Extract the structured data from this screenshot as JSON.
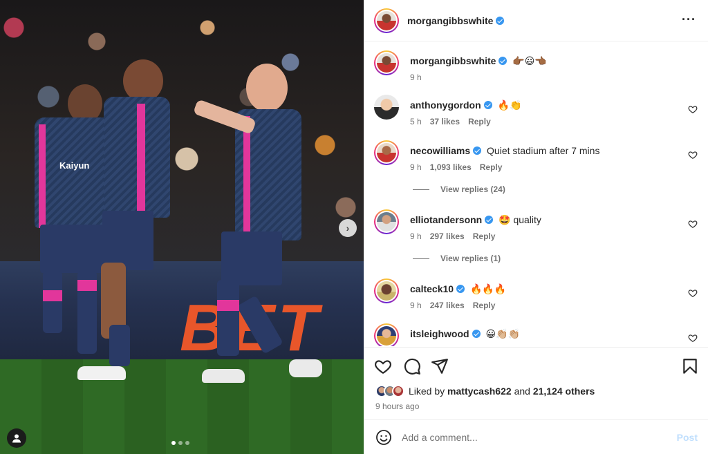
{
  "post": {
    "author": "morgangibbswhite",
    "caption_emoji": "👉🏾😃👈🏾",
    "caption_time": "9 h",
    "more_icon": "more-horizontal-icon"
  },
  "comments": [
    {
      "user": "anthonygordon",
      "text": "🔥👏",
      "time": "5 h",
      "likes": "37 likes",
      "reply": "Reply"
    },
    {
      "user": "necowilliams",
      "text": "Quiet stadium after 7 mins",
      "time": "9 h",
      "likes": "1,093 likes",
      "reply": "Reply",
      "view_replies": "View replies (24)"
    },
    {
      "user": "elliotandersonn",
      "text": "🤩 quality",
      "time": "9 h",
      "likes": "297 likes",
      "reply": "Reply",
      "view_replies": "View replies (1)"
    },
    {
      "user": "calteck10",
      "text": "🔥🔥🔥",
      "time": "9 h",
      "likes": "247 likes",
      "reply": "Reply"
    },
    {
      "user": "itsleighwood",
      "text": "😀👏🏼👏🏼",
      "time": "",
      "likes": "",
      "reply": ""
    }
  ],
  "actions": {
    "like_icon": "heart-icon",
    "comment_icon": "comment-icon",
    "share_icon": "share-icon",
    "save_icon": "bookmark-icon"
  },
  "likes": {
    "prefix": "Liked by",
    "first_user": "mattycash622",
    "and": "and",
    "others": "21,124 others"
  },
  "timeago": "9 hours ago",
  "add_comment": {
    "placeholder": "Add a comment...",
    "post_label": "Post",
    "emoji_icon": "smiley-icon"
  },
  "photo": {
    "carousel_next_icon": "chevron-right-icon",
    "tag_icon": "user-tag-icon",
    "dots_total": 3,
    "dot_active": 1,
    "sponsor_text": "Kaiyun",
    "board_text": "BET"
  },
  "colors": {
    "verified": "#3897f0",
    "link_disabled": "#c0dffd",
    "secondary_text": "#737373",
    "divider": "#efefef"
  }
}
